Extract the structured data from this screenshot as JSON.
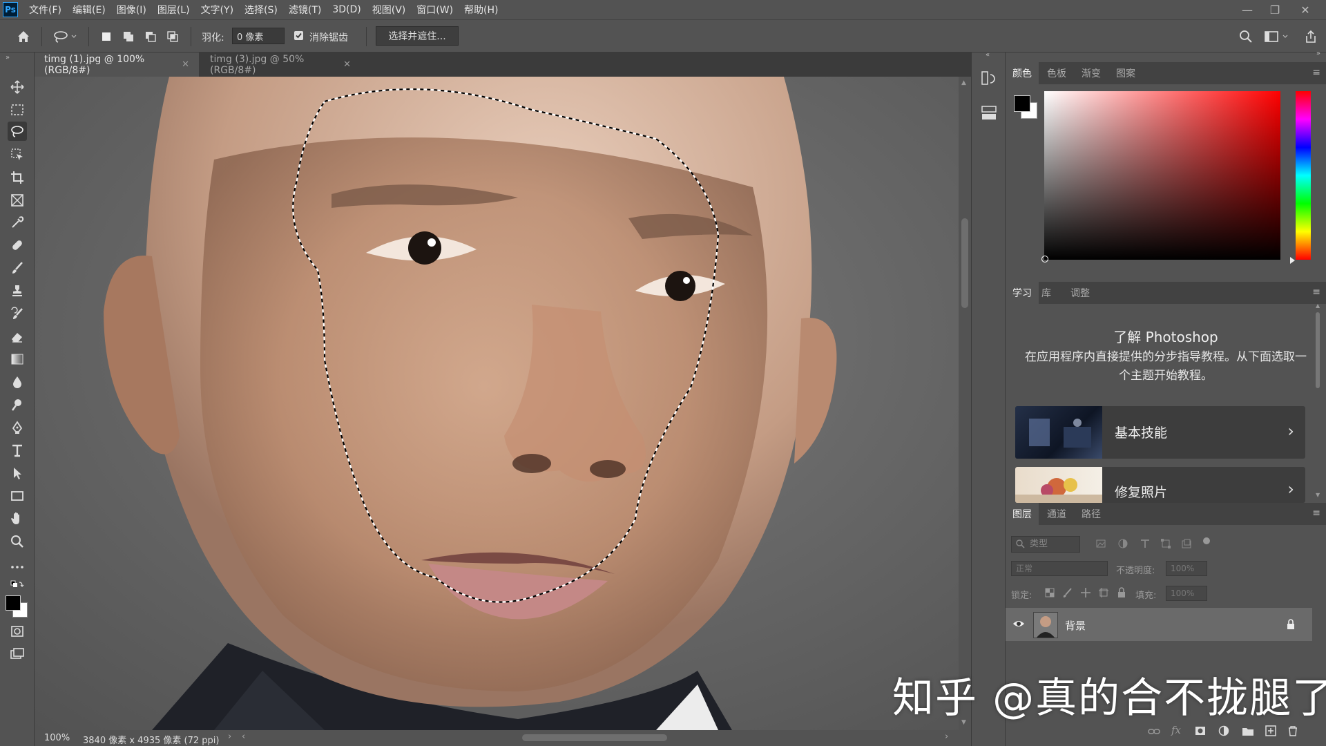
{
  "app": {
    "logo": "Ps"
  },
  "menu": [
    "文件(F)",
    "编辑(E)",
    "图像(I)",
    "图层(L)",
    "文字(Y)",
    "选择(S)",
    "滤镜(T)",
    "3D(D)",
    "视图(V)",
    "窗口(W)",
    "帮助(H)"
  ],
  "options": {
    "feather_label": "羽化:",
    "feather_value": "0 像素",
    "antialias_label": "消除锯齿",
    "antialias_checked": true,
    "select_mask_label": "选择并遮住..."
  },
  "tabs": [
    {
      "label": "timg (1).jpg @ 100%(RGB/8#)",
      "active": true
    },
    {
      "label": "timg (3).jpg @ 50%(RGB/8#)",
      "active": false
    }
  ],
  "status": {
    "zoom": "100%",
    "doc_info": "3840 像素 x 4935 像素 (72 ppi)"
  },
  "color_panel": {
    "tabs": [
      "颜色",
      "色板",
      "渐变",
      "图案"
    ],
    "fg_color": "#000000",
    "bg_color": "#ffffff",
    "hue_color": "#ff0000"
  },
  "learn_panel": {
    "tabs": [
      "学习",
      "库",
      "调整"
    ],
    "title": "了解 Photoshop",
    "description": "在应用程序内直接提供的分步指导教程。从下面选取一个主题开始教程。",
    "cards": [
      "基本技能",
      "修复照片"
    ]
  },
  "layers_panel": {
    "tabs": [
      "图层",
      "通道",
      "路径"
    ],
    "filter_placeholder": "类型",
    "blend_mode": "正常",
    "opacity_label": "不透明度:",
    "opacity_value": "100%",
    "lock_label": "锁定:",
    "fill_label": "填充:",
    "fill_value": "100%",
    "layers": [
      {
        "name": "背景",
        "visible": true,
        "locked": true
      }
    ]
  },
  "watermark": "知乎 @真的合不拢腿了"
}
